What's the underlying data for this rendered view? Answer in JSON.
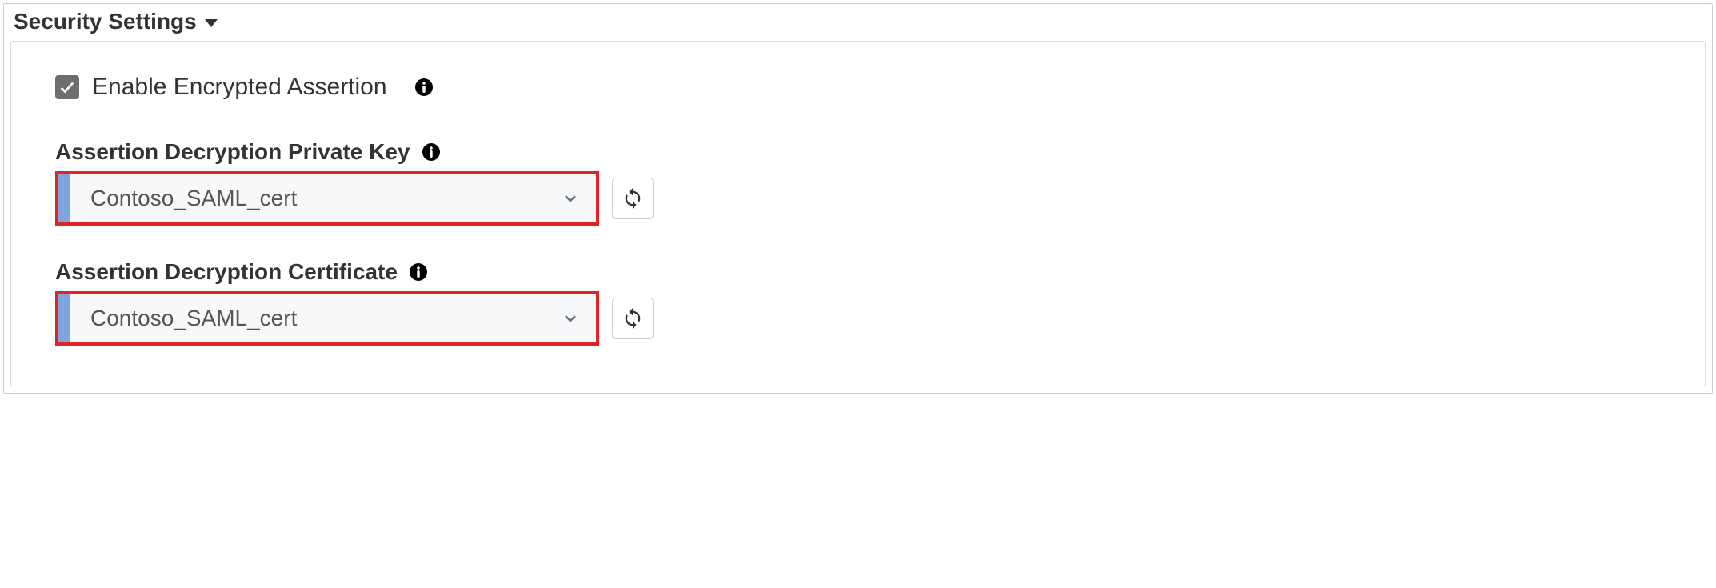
{
  "panel": {
    "title": "Security Settings"
  },
  "checkbox": {
    "label": "Enable Encrypted Assertion",
    "checked": true
  },
  "fields": {
    "privateKey": {
      "label": "Assertion Decryption Private Key",
      "value": "Contoso_SAML_cert"
    },
    "certificate": {
      "label": "Assertion Decryption Certificate",
      "value": "Contoso_SAML_cert"
    }
  }
}
